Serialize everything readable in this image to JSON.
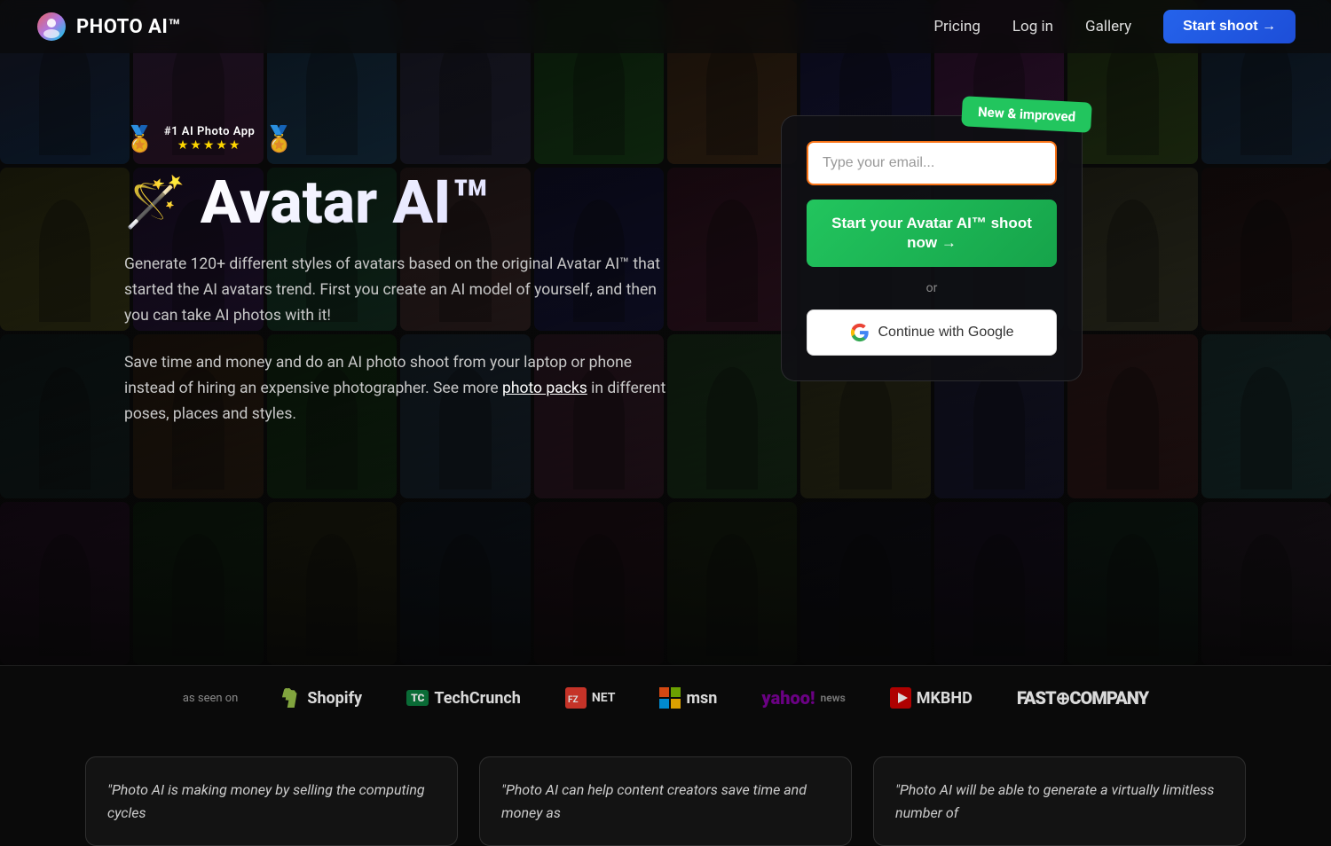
{
  "nav": {
    "logo_text_photo": "PHOTO",
    "logo_text_ai": " AI™",
    "pricing": "Pricing",
    "login": "Log in",
    "gallery": "Gallery",
    "start_shoot": "Start shoot →"
  },
  "hero": {
    "award_title": "#1 AI Photo App",
    "stars": "★★★★★",
    "title_emoji": "🪄",
    "title": "Avatar AI™",
    "desc1": "Generate 120+ different styles of avatars based on the original Avatar AI™ that started the AI avatars trend. First you create an AI model of yourself, and then you can take AI photos with it!",
    "desc2_prefix": "Save time and money and do an AI photo shoot from your laptop or phone instead of hiring an expensive photographer. See more ",
    "photo_packs_link": "photo packs",
    "desc2_suffix": " in different poses, places and styles.",
    "new_badge": "New & improved",
    "email_placeholder": "Type your email...",
    "cta_button": "Start your Avatar AI™ shoot now →",
    "or_text": "or",
    "google_button": "Continue with Google"
  },
  "press": {
    "label": "as seen on",
    "logos": [
      {
        "name": "Shopify",
        "symbol": "🛍"
      },
      {
        "name": "TechCrunch",
        "symbol": "TC"
      },
      {
        "name": "FZNET",
        "symbol": "FZ"
      },
      {
        "name": "msn",
        "symbol": "M"
      },
      {
        "name": "yahoo! news",
        "symbol": "Y!"
      },
      {
        "name": "MKBHD",
        "symbol": "►"
      },
      {
        "name": "FAST COMPANY",
        "symbol": "FC"
      }
    ]
  },
  "testimonials": [
    {
      "text": "\"Photo AI is making money by selling the computing cycles"
    },
    {
      "text": "\"Photo AI can help content creators save time and money as"
    },
    {
      "text": "\"Photo AI will be able to generate a virtually limitless number of"
    }
  ]
}
